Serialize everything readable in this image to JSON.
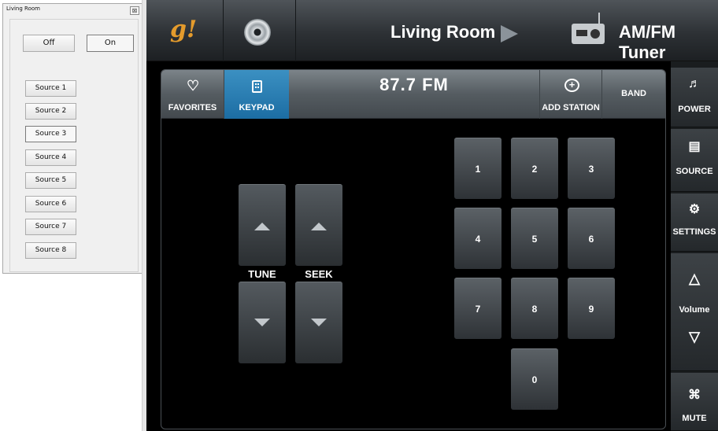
{
  "dialog": {
    "title": "Living Room",
    "close_glyph": "⊠",
    "off_label": "Off",
    "on_label": "On",
    "sources": [
      "Source 1",
      "Source 2",
      "Source 3",
      "Source 4",
      "Source 5",
      "Source 6",
      "Source 7",
      "Source 8"
    ],
    "selected_source": "Source 3"
  },
  "app": {
    "logo_text": "g!",
    "room_name": "Living Room",
    "source_name": "AM/FM Tuner",
    "tabs": {
      "favorites": "FAVORITES",
      "keypad": "KEYPAD",
      "add_station": "ADD STATION",
      "band": "BAND"
    },
    "frequency": "87.7  FM",
    "tune_label": "TUNE",
    "seek_label": "SEEK",
    "keypad": [
      "1",
      "2",
      "3",
      "4",
      "5",
      "6",
      "7",
      "8",
      "9",
      "0"
    ],
    "side": {
      "power": "POWER",
      "source": "SOURCE",
      "settings": "SETTINGS",
      "volume": "Volume",
      "mute": "MUTE"
    }
  },
  "colors": {
    "accent_blue": "#2a7fb5",
    "logo_orange": "#e49b2c"
  }
}
